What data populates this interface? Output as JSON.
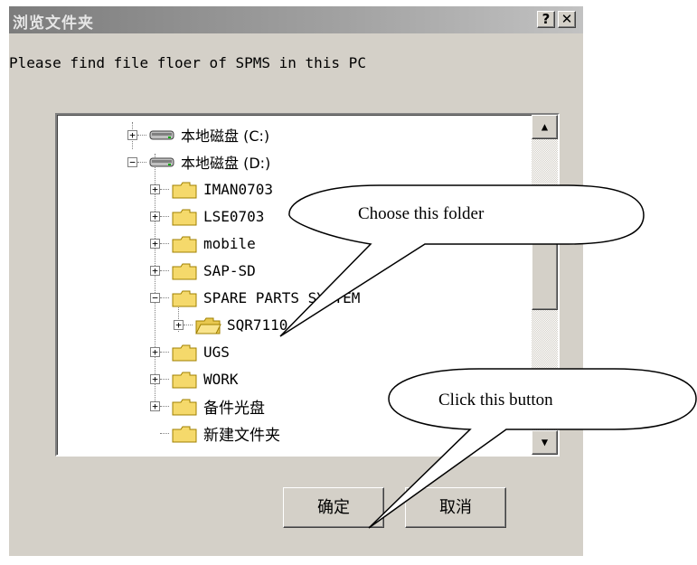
{
  "dialog": {
    "title": "浏览文件夹",
    "help_label": "?",
    "close_label": "✕",
    "prompt": "Please find file floer of SPMS in this PC",
    "ok_label": "确定",
    "cancel_label": "取消"
  },
  "tree": {
    "items": [
      {
        "label": "本地磁盘 (C:)",
        "icon": "drive-icon",
        "expander": "+"
      },
      {
        "label": "本地磁盘 (D:)",
        "icon": "drive-icon",
        "expander": "−"
      },
      {
        "label": "IMAN0703",
        "icon": "folder-icon",
        "expander": "+"
      },
      {
        "label": "LSE0703",
        "icon": "folder-icon",
        "expander": "+"
      },
      {
        "label": "mobile",
        "icon": "folder-icon",
        "expander": "+"
      },
      {
        "label": "SAP-SD",
        "icon": "folder-icon",
        "expander": "+"
      },
      {
        "label": "SPARE PARTS SYSTEM",
        "icon": "folder-icon",
        "expander": "−"
      },
      {
        "label": "SQR7110",
        "icon": "open-folder-icon",
        "expander": "+"
      },
      {
        "label": "UGS",
        "icon": "folder-icon",
        "expander": "+"
      },
      {
        "label": "WORK",
        "icon": "folder-icon",
        "expander": "+"
      },
      {
        "label": "备件光盘",
        "icon": "folder-icon",
        "expander": "+"
      },
      {
        "label": "新建文件夹",
        "icon": "folder-icon",
        "expander": ""
      }
    ]
  },
  "scrollbar": {
    "up_icon": "▲",
    "down_icon": "▼"
  },
  "callouts": {
    "folder_hint": "Choose this folder",
    "button_hint": "Click this button"
  },
  "colors": {
    "dialog_bg": "#d4d0c8",
    "folder": "#f5d96b"
  }
}
